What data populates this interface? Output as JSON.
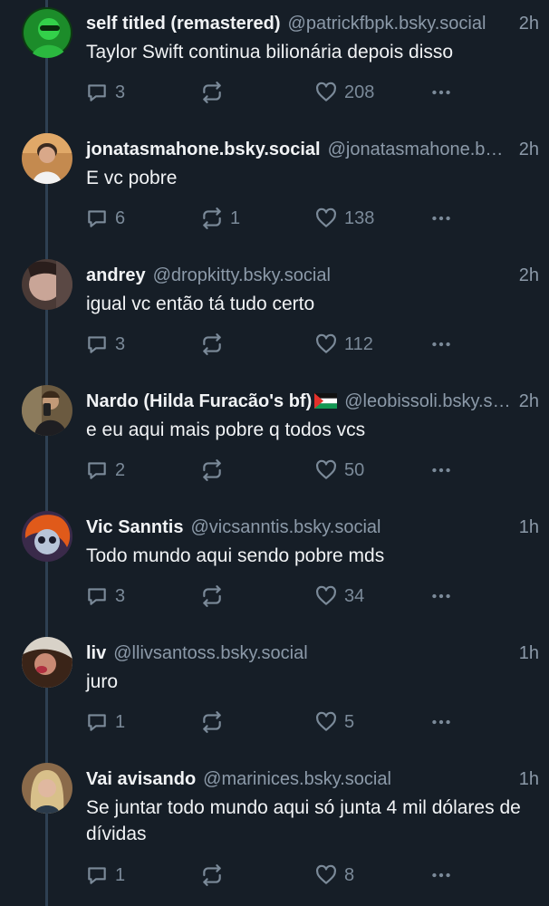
{
  "colors": {
    "background": "#161e27",
    "thread_line": "#2e4052",
    "text_primary": "#f1f3f5",
    "text_secondary": "#8c9aa9",
    "icon": "#7b8a99"
  },
  "posts": [
    {
      "author": "self titled (remastered)",
      "handle": "@patrickfbpk.bsky.social",
      "time": "2h",
      "text": "Taylor Swift continua bilionária depois disso",
      "replies": "3",
      "reposts": "",
      "likes": "208"
    },
    {
      "author": "jonatasmahone.bsky.social",
      "handle": "@jonatasmahone.bsky.social",
      "time": "2h",
      "text": "E vc pobre",
      "replies": "6",
      "reposts": "1",
      "likes": "138"
    },
    {
      "author": "andrey",
      "handle": "@dropkitty.bsky.social",
      "time": "2h",
      "text": "igual vc então tá tudo certo",
      "replies": "3",
      "reposts": "",
      "likes": "112"
    },
    {
      "author": "Nardo (Hilda Furacão's bf)",
      "author_flag": "palestine-flag",
      "handle": "@leobissoli.bsky.social",
      "time": "2h",
      "text": "e eu aqui mais pobre q todos vcs",
      "replies": "2",
      "reposts": "",
      "likes": "50"
    },
    {
      "author": "Vic Sanntis",
      "handle": "@vicsanntis.bsky.social",
      "time": "1h",
      "text": "Todo mundo aqui sendo pobre mds",
      "replies": "3",
      "reposts": "",
      "likes": "34"
    },
    {
      "author": "liv",
      "handle": "@llivsantoss.bsky.social",
      "time": "1h",
      "text": "juro",
      "replies": "1",
      "reposts": "",
      "likes": "5"
    },
    {
      "author": "Vai avisando",
      "handle": "@marinices.bsky.social",
      "time": "1h",
      "text": "Se juntar todo mundo aqui só junta 4 mil dólares de dívidas",
      "replies": "1",
      "reposts": "",
      "likes": "8"
    }
  ]
}
